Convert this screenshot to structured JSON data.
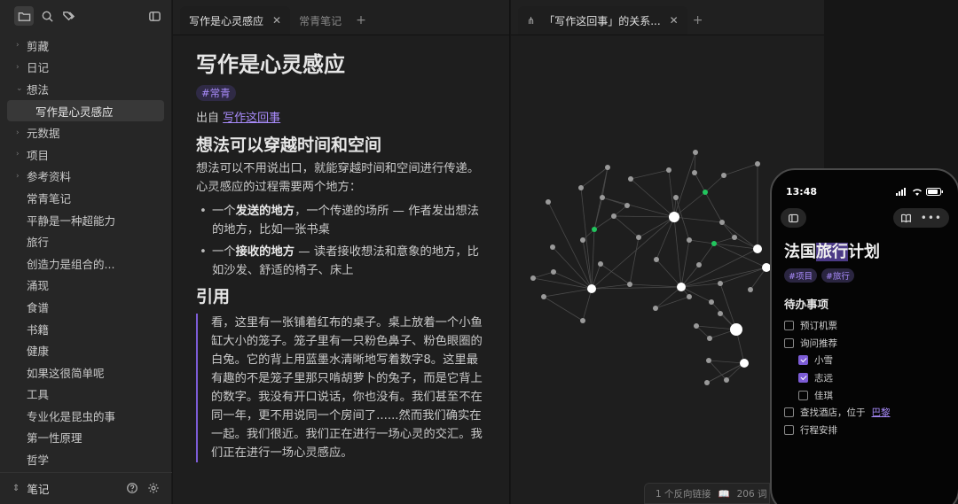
{
  "sidebar": {
    "items": [
      {
        "label": "剪藏",
        "kind": "folder"
      },
      {
        "label": "日记",
        "kind": "folder"
      },
      {
        "label": "想法",
        "kind": "folder-open"
      },
      {
        "label": "写作是心灵感应",
        "kind": "selected"
      },
      {
        "label": "元数据",
        "kind": "folder"
      },
      {
        "label": "项目",
        "kind": "folder"
      },
      {
        "label": "参考资料",
        "kind": "folder"
      },
      {
        "label": "常青笔记",
        "kind": "file"
      },
      {
        "label": "平静是一种超能力",
        "kind": "file"
      },
      {
        "label": "旅行",
        "kind": "file"
      },
      {
        "label": "创造力是组合的...",
        "kind": "file"
      },
      {
        "label": "涌现",
        "kind": "file"
      },
      {
        "label": "食谱",
        "kind": "file"
      },
      {
        "label": "书籍",
        "kind": "file"
      },
      {
        "label": "健康",
        "kind": "file"
      },
      {
        "label": "如果这很简单呢",
        "kind": "file"
      },
      {
        "label": "工具",
        "kind": "file"
      },
      {
        "label": "专业化是昆虫的事",
        "kind": "file"
      },
      {
        "label": "第一性原理",
        "kind": "file"
      },
      {
        "label": "哲学",
        "kind": "file"
      }
    ],
    "vault_name": "笔记"
  },
  "left_pane": {
    "tabs": [
      {
        "label": "写作是心灵感应",
        "active": true
      },
      {
        "label": "常青笔记",
        "active": false
      }
    ],
    "note": {
      "title": "写作是心灵感应",
      "tag": "#常青",
      "source_prefix": "出自",
      "source_link": "写作这回事",
      "h2_1": "想法可以穿越时间和空间",
      "para_1": "想法可以不用说出口，就能穿越时间和空间进行传递。心灵感应的过程需要两个地方：",
      "bullet_1_bold": "发送的地方",
      "bullet_1_pre": "一个",
      "bullet_1_rest": "，一个传递的场所 — 作者发出想法的地方，比如一张书桌",
      "bullet_2_pre": "一个",
      "bullet_2_bold": "接收的地方",
      "bullet_2_rest": " — 读者接收想法和意象的地方，比如沙发、舒适的椅子、床上",
      "h2_2": "引用",
      "quote": "看，这里有一张铺着红布的桌子。桌上放着一个小鱼缸大小的笼子。笼子里有一只粉色鼻子、粉色眼圈的白兔。它的背上用蓝墨水清晰地写着数字8。这里最有趣的不是笼子里那只啃胡萝卜的兔子，而是它背上的数字。我没有开口说话，你也没有。我们甚至不在同一年，更不用说同一个房间了......然而我们确实在一起。我们很近。我们正在进行一场心灵的交汇。我们正在进行一场心灵感应。"
    }
  },
  "right_pane": {
    "tab_label": "「写作这回事」的关系..."
  },
  "statusbar": {
    "backlinks": "1 个反向链接",
    "words": "206 词"
  },
  "phone": {
    "time": "13:48",
    "title_pre": "法国",
    "title_hl": "旅行",
    "title_post": "计划",
    "tags": [
      "#项目",
      "#旅行"
    ],
    "section": "待办事项",
    "todos": [
      {
        "label": "预订机票",
        "checked": false,
        "sub": false
      },
      {
        "label": "询问推荐",
        "checked": false,
        "sub": false
      },
      {
        "label": "小雪",
        "checked": true,
        "sub": true
      },
      {
        "label": "志远",
        "checked": true,
        "sub": true
      },
      {
        "label": "佳琪",
        "checked": false,
        "sub": true
      },
      {
        "label": "查找酒店，位于 ",
        "link": "巴黎",
        "checked": false,
        "sub": false
      },
      {
        "label": "行程安排",
        "checked": false,
        "sub": false
      }
    ]
  },
  "colors": {
    "accent": "#a88bfa",
    "graph_highlight": "#22c55e",
    "graph_node": "#9a9a9a"
  }
}
